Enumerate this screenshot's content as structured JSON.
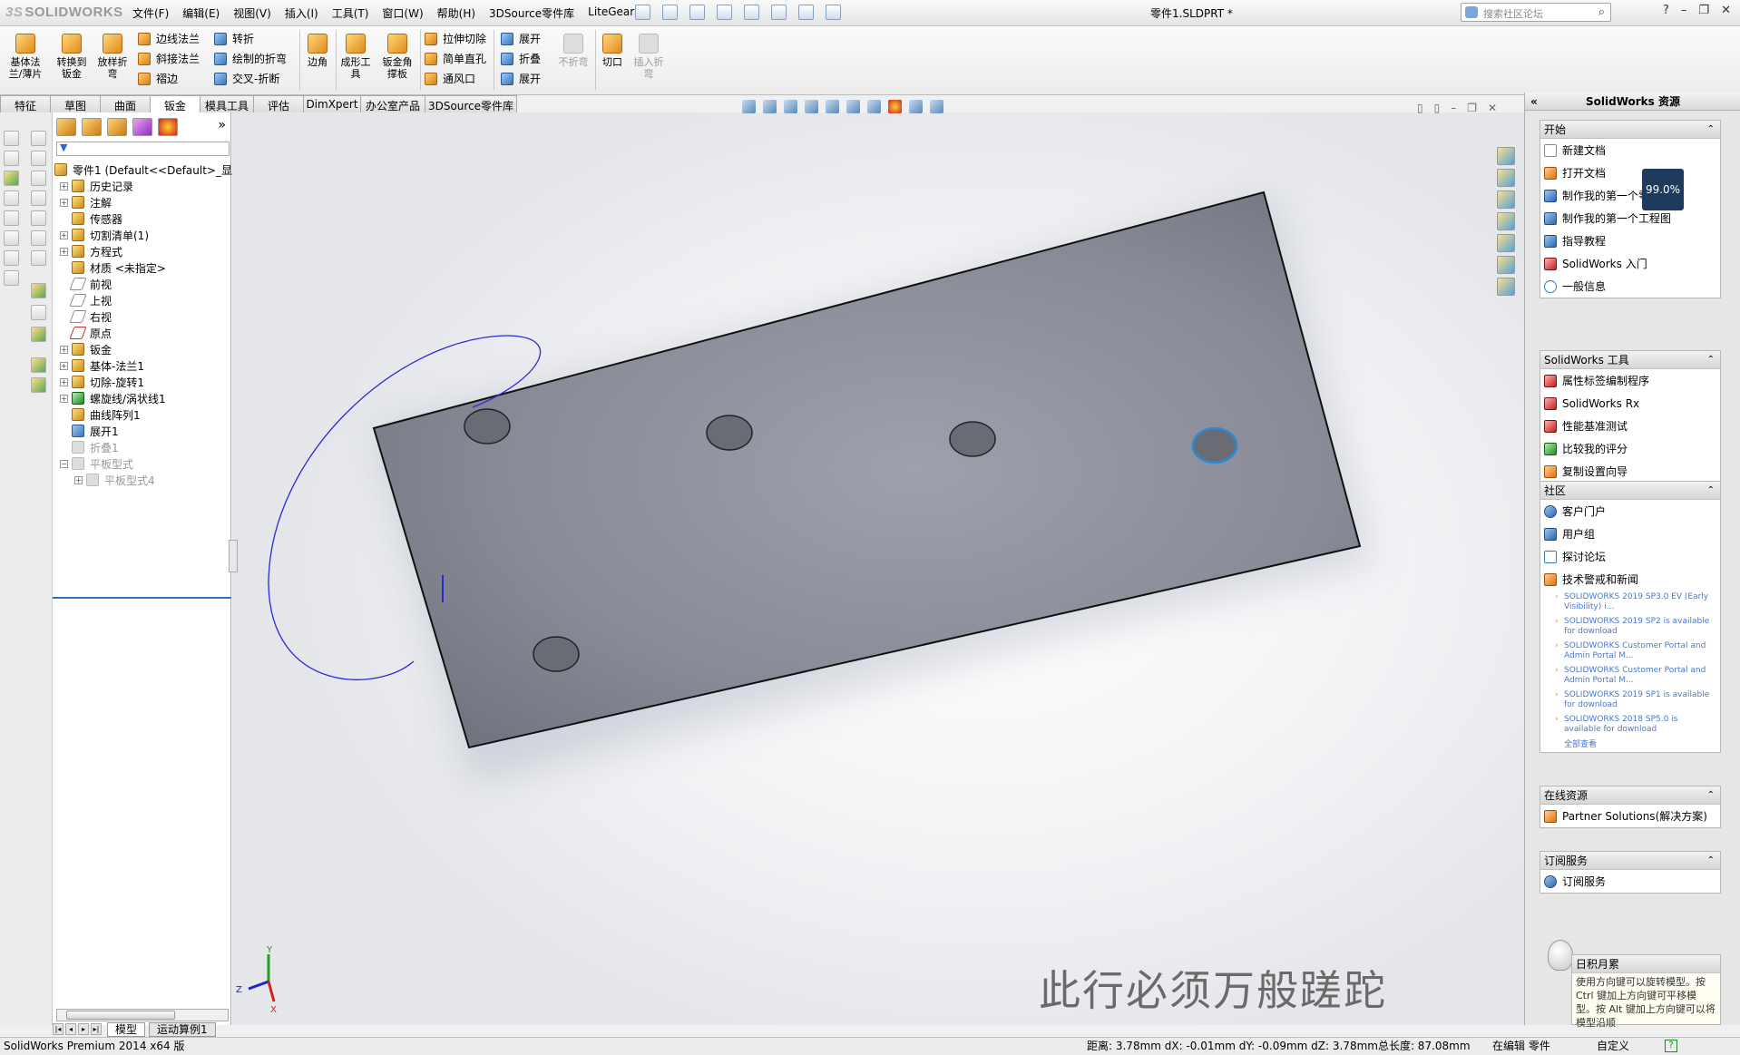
{
  "app": {
    "logo": "SOLIDWORKS",
    "doc_title": "零件1.SLDPRT *",
    "search_placeholder": "搜索社区论坛"
  },
  "menu": [
    "文件(F)",
    "编辑(E)",
    "视图(V)",
    "插入(I)",
    "工具(T)",
    "窗口(W)",
    "帮助(H)",
    "3DSource零件库",
    "LiteGears"
  ],
  "ribbon": {
    "big_buttons": [
      {
        "label": "基体法\n兰/薄片",
        "icon": "base-flange-icon"
      },
      {
        "label": "转换到\n钣金",
        "icon": "convert-sheetmetal-icon"
      },
      {
        "label": "放样折\n弯",
        "icon": "lofted-bend-icon"
      },
      {
        "label": "边角",
        "icon": "corner-icon"
      },
      {
        "label": "成形工\n具",
        "icon": "forming-tool-icon"
      },
      {
        "label": "钣金角\n撑板",
        "icon": "gusset-icon"
      },
      {
        "label": "不折弯",
        "icon": "no-bends-icon"
      },
      {
        "label": "切口",
        "icon": "rip-icon"
      },
      {
        "label": "插入折\n弯",
        "icon": "insert-bends-icon"
      }
    ],
    "small_col1": [
      "边线法兰",
      "斜接法兰",
      "褶边"
    ],
    "small_col2": [
      "转折",
      "绘制的折弯",
      "交叉-折断"
    ],
    "small_col3": [
      "拉伸切除",
      "简单直孔",
      "通风口"
    ],
    "small_col4": [
      "展开",
      "折叠",
      "展开"
    ]
  },
  "tabs": [
    "特征",
    "草图",
    "曲面",
    "钣金",
    "模具工具",
    "评估",
    "DimXpert",
    "办公室产品",
    "3DSource零件库"
  ],
  "active_tab": "钣金",
  "tree": {
    "root": "零件1 (Default<<Default>_显示",
    "items": [
      {
        "label": "历史记录",
        "pm": "+"
      },
      {
        "label": "注解",
        "pm": "+"
      },
      {
        "label": "传感器",
        "pm": ""
      },
      {
        "label": "切割清单(1)",
        "pm": "+"
      },
      {
        "label": "方程式",
        "pm": "+"
      },
      {
        "label": "材质 <未指定>",
        "pm": ""
      },
      {
        "label": "前视",
        "pm": ""
      },
      {
        "label": "上视",
        "pm": ""
      },
      {
        "label": "右视",
        "pm": ""
      },
      {
        "label": "原点",
        "pm": ""
      },
      {
        "label": "钣金",
        "pm": "+"
      },
      {
        "label": "基体-法兰1",
        "pm": "+"
      },
      {
        "label": "切除-旋转1",
        "pm": "+"
      },
      {
        "label": "螺旋线/涡状线1",
        "pm": "+"
      },
      {
        "label": "曲线阵列1",
        "pm": ""
      },
      {
        "label": "展开1",
        "pm": ""
      },
      {
        "label": "折叠1",
        "pm": "",
        "disabled": true
      },
      {
        "label": "平板型式",
        "pm": "−",
        "disabled": true
      },
      {
        "label": "平板型式4",
        "pm": "+",
        "disabled": true,
        "indent": true
      }
    ]
  },
  "taskpane": {
    "title": "SolidWorks 资源",
    "sections": [
      {
        "title": "开始",
        "items": [
          "新建文档",
          "打开文档",
          "制作我的第一个零件",
          "制作我的第一个工程图",
          "指导教程",
          "SolidWorks 入门",
          "一般信息"
        ]
      },
      {
        "title": "SolidWorks 工具",
        "items": [
          "属性标签编制程序",
          "SolidWorks Rx",
          "性能基准测试",
          "比较我的评分",
          "复制设置向导"
        ]
      },
      {
        "title": "社区",
        "items": [
          "客户门户",
          "用户组",
          "探讨论坛",
          "技术警戒和新闻"
        ]
      },
      {
        "title": "在线资源",
        "items": [
          "Partner Solutions(解决方案)"
        ]
      },
      {
        "title": "订阅服务",
        "items": [
          "订阅服务"
        ]
      }
    ],
    "news": [
      "SOLIDWORKS 2019 SP3.0 EV (Early Visibility) i...",
      "SOLIDWORKS 2019 SP2 is available for download",
      "SOLIDWORKS Customer Portal and Admin Portal M...",
      "SOLIDWORKS Customer Portal and Admin Portal M...",
      "SOLIDWORKS 2019 SP1 is available for download",
      "SOLIDWORKS 2018 SP5.0 is available for download"
    ],
    "view_all": "全部查看",
    "tip_title": "日积月累",
    "tip_text": "使用方向键可以旋转模型。按 Ctrl 键加上方向键可平移模型。按 Alt 键加上方向键可以将模型沿顺",
    "progress": "99.0%"
  },
  "viewport": {
    "watermark": "此行必须万般蹉跎",
    "triad": {
      "x": "X",
      "y": "Y",
      "z": "Z"
    }
  },
  "bottom_tabs": [
    "模型",
    "运动算例1"
  ],
  "status": {
    "left": "SolidWorks Premium 2014 x64 版",
    "measure": "距离: 3.78mm   dX: -0.01mm   dY: -0.09mm   dZ: 3.78mm总长度: 87.08mm",
    "mode": "在编辑 零件",
    "custom": "自定义"
  }
}
